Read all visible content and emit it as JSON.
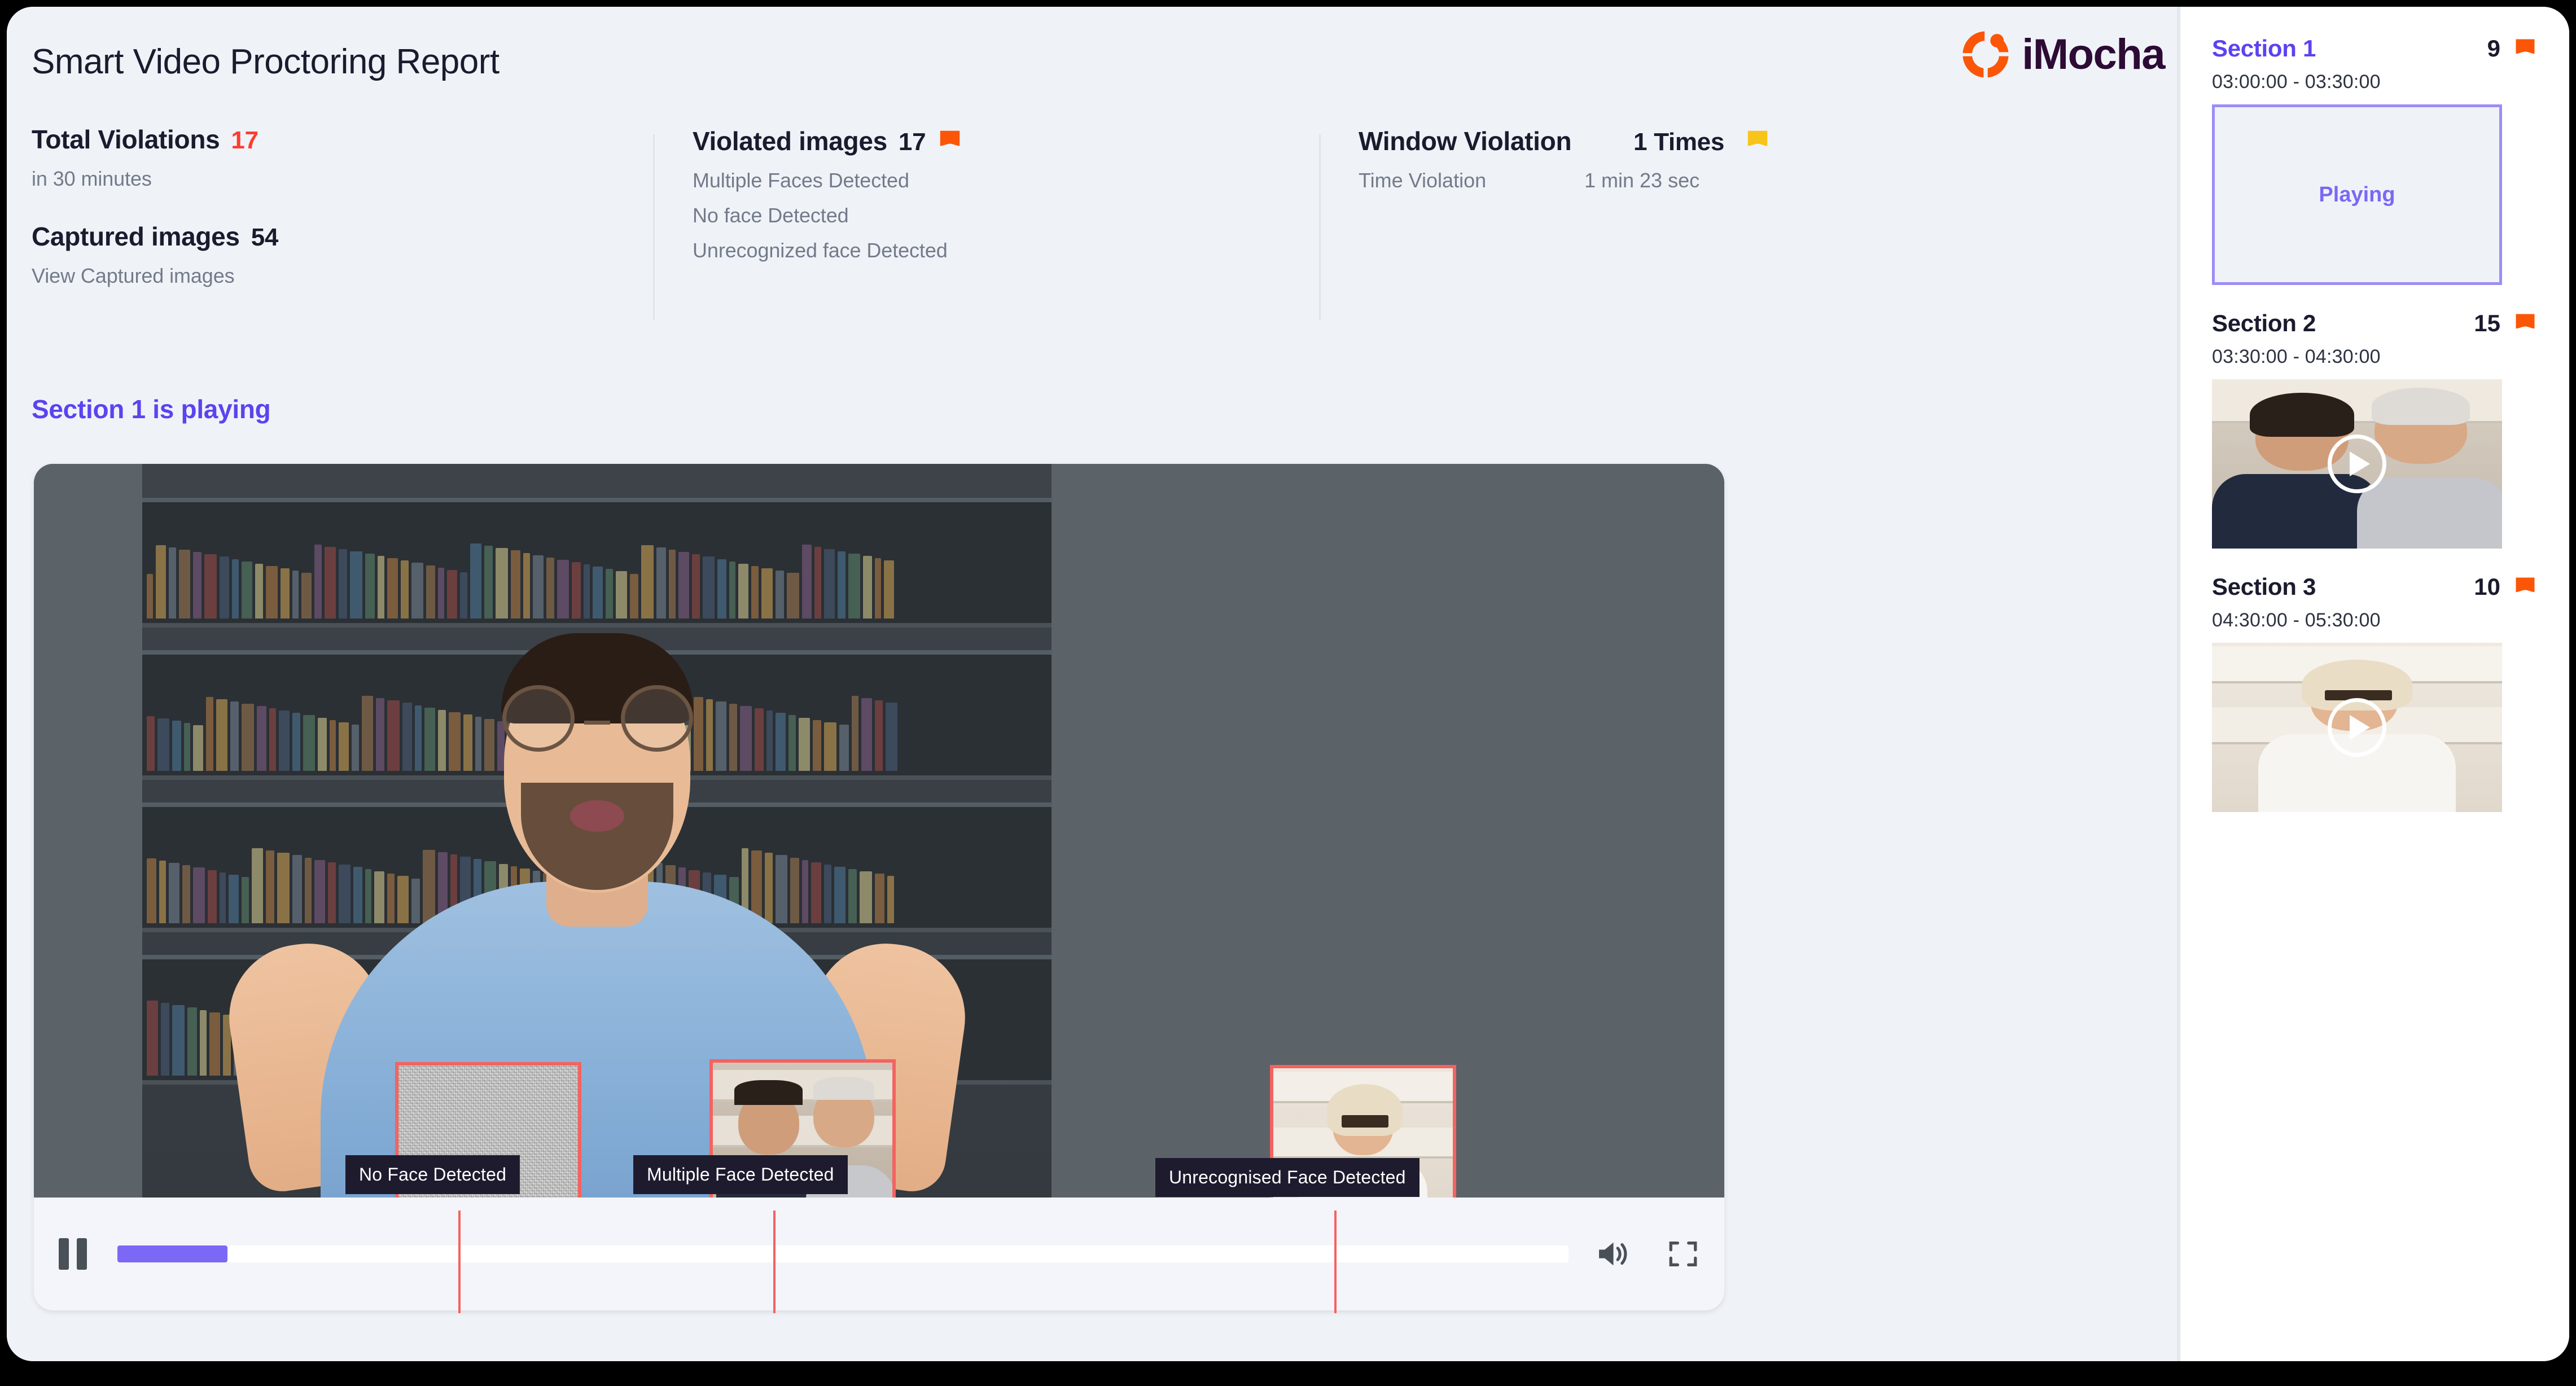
{
  "report": {
    "title": "Smart Video Proctoring Report",
    "brand": {
      "wordmark": "iMocha",
      "mark_icon": "imocha-ring-icon",
      "mark_color": "#fb5607",
      "word_color": "#2d0b35"
    }
  },
  "stats": {
    "total_violations": {
      "label": "Total Violations",
      "value": "17",
      "value_color": "#ff3b30",
      "sub": "in 30 minutes"
    },
    "captured_images": {
      "label": "Captured images",
      "value": "54",
      "sub": "View Captured images"
    },
    "violated_images": {
      "label": "Violated images",
      "value": "17",
      "flag_icon": "flag-icon",
      "flag_color": "#fb5607",
      "items": [
        "Multiple Faces Detected",
        "No face Detected",
        "Unrecognized face Detected"
      ]
    },
    "window_violation": {
      "label": "Window Violation",
      "value": "1 Times",
      "flag_icon": "flag-icon",
      "flag_color": "#f9c41a",
      "time_label": "Time Violation",
      "time_value": "1 min 23 sec"
    }
  },
  "player": {
    "now_playing_caption": "Section 1 is playing",
    "caption_color": "#5b43f0",
    "pause_icon": "pause-icon",
    "volume_icon": "volume-high-icon",
    "fullscreen_icon": "fullscreen-icon",
    "progress_percent": "7.6",
    "progress_color": "#7b68f5",
    "detections": [
      {
        "label": "No Face Detected",
        "box_color": "#f4635f"
      },
      {
        "label": "Multiple Face Detected",
        "box_color": "#f4635f"
      },
      {
        "label": "Unrecognised Face Detected",
        "box_color": "#f4635f"
      }
    ]
  },
  "sidebar": {
    "sections": [
      {
        "title": "Section 1",
        "count": "9",
        "flag_icon": "flag-icon",
        "flag_color": "#fb5607",
        "time_range": "03:00:00 - 03:30:00",
        "state": "Playing",
        "active": true
      },
      {
        "title": "Section 2",
        "count": "15",
        "flag_icon": "flag-icon",
        "flag_color": "#fb5607",
        "time_range": "03:30:00 - 04:30:00",
        "thumb_play_icon": "play-icon",
        "active": false
      },
      {
        "title": "Section 3",
        "count": "10",
        "flag_icon": "flag-icon",
        "flag_color": "#fb5607",
        "time_range": "04:30:00 - 05:30:00",
        "thumb_play_icon": "play-icon",
        "active": false
      }
    ]
  }
}
